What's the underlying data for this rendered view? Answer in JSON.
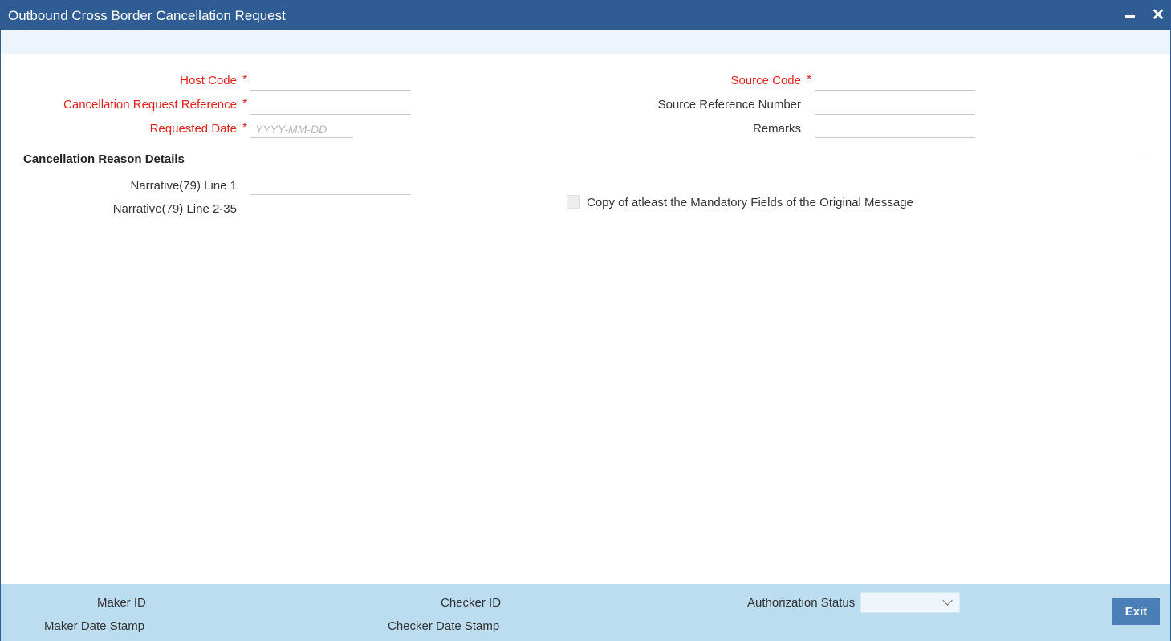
{
  "window": {
    "title": "Outbound Cross Border Cancellation Request",
    "minimize_icon": "minimize-icon",
    "close_icon": "close-icon",
    "close_glyph": "✕"
  },
  "form": {
    "host_code": {
      "label": "Host Code",
      "required": "*",
      "value": ""
    },
    "cancellation_request_reference": {
      "label": "Cancellation Request Reference",
      "required": "*",
      "value": ""
    },
    "requested_date": {
      "label": "Requested Date",
      "required": "*",
      "value": "",
      "placeholder": "YYYY-MM-DD"
    },
    "source_code": {
      "label": "Source Code",
      "required": "*",
      "value": ""
    },
    "source_reference_number": {
      "label": "Source Reference Number",
      "value": ""
    },
    "remarks": {
      "label": "Remarks",
      "value": ""
    }
  },
  "cancellation_reason": {
    "title": "Cancellation Reason Details",
    "narrative_line1": {
      "label": "Narrative(79) Line 1",
      "value": ""
    },
    "narrative_line2_35": {
      "label": "Narrative(79) Line 2-35"
    },
    "copy_mandatory": {
      "label": "Copy of atleast the Mandatory Fields of the Original Message",
      "checked": false
    }
  },
  "footer": {
    "maker_id": "Maker ID",
    "maker_date_stamp": "Maker Date Stamp",
    "checker_id": "Checker ID",
    "checker_date_stamp": "Checker Date Stamp",
    "authorization_status": "Authorization Status",
    "authorization_status_value": "",
    "exit_label": "Exit"
  },
  "colors": {
    "titlebar": "#2f5d93",
    "required": "#e2211c",
    "footer": "#bcdcf0",
    "button": "#4a7fb6"
  }
}
